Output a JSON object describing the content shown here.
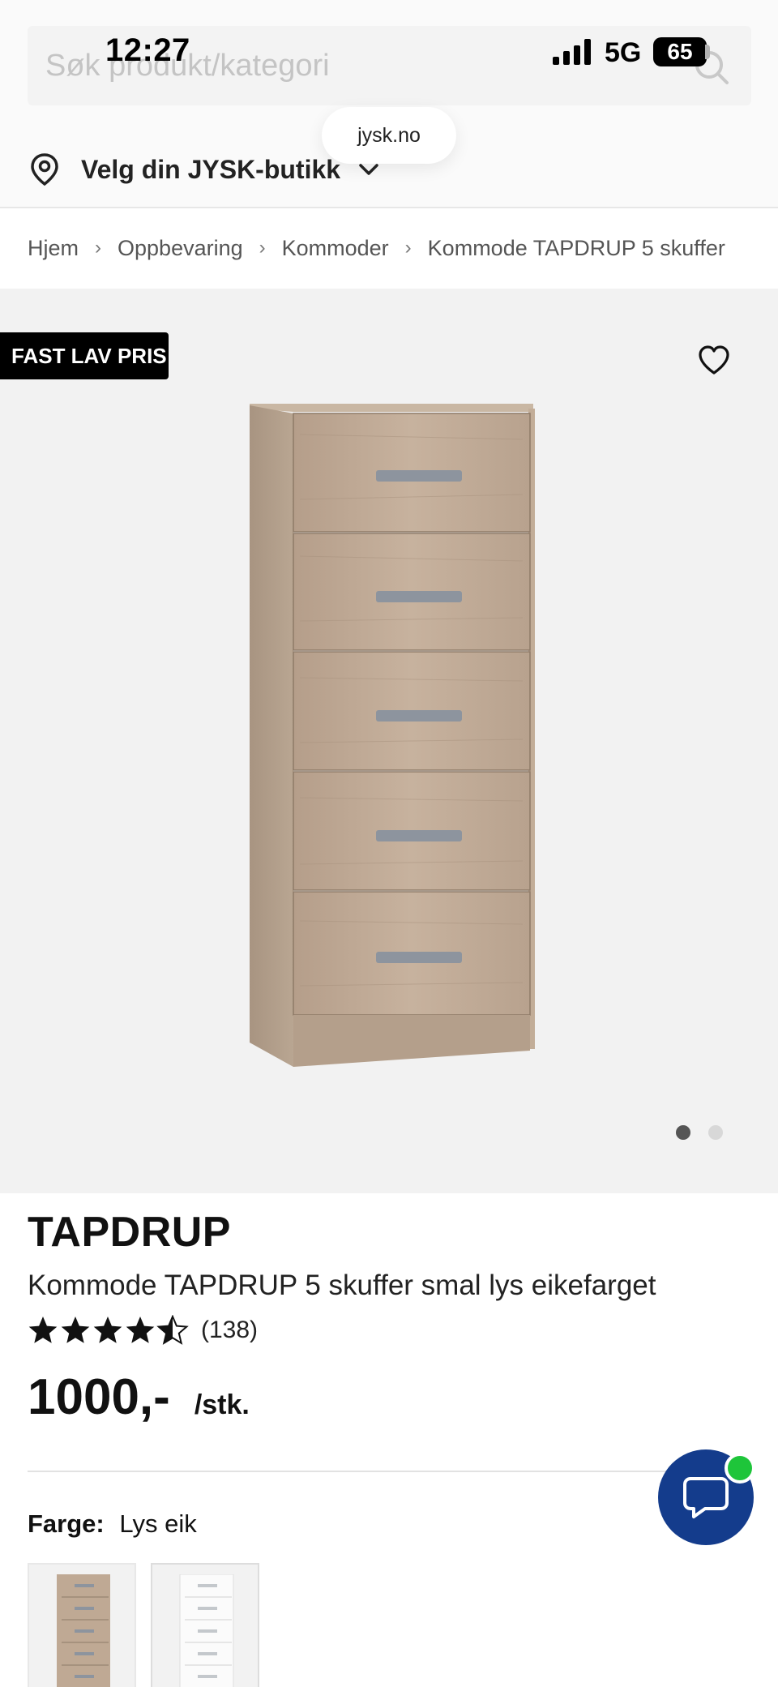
{
  "status_bar": {
    "time": "12:27",
    "network": "5G",
    "battery": "65"
  },
  "search": {
    "placeholder": "Søk produkt/kategori",
    "icon": "search-icon"
  },
  "browser": {
    "url": "jysk.no"
  },
  "store_selector": {
    "label": "Velg din JYSK-butikk",
    "icon": "map-pin-icon"
  },
  "breadcrumb": [
    "Hjem",
    "Oppbevaring",
    "Kommoder",
    "Kommode TAPDRUP 5 skuffer"
  ],
  "gallery": {
    "badge": "FAST LAV PRIS",
    "image_count": 2,
    "active_index": 0
  },
  "product": {
    "brand": "TAPDRUP",
    "title": "Kommode TAPDRUP 5 skuffer smal lys eikefarget",
    "rating": 4.5,
    "review_count": "(138)",
    "price": "1000,-",
    "price_unit": "/stk.",
    "color_label": "Farge:",
    "color_value": "Lys eik",
    "swatches": [
      "Lys eik",
      "Hvit"
    ]
  },
  "colors": {
    "chat_bg": "#143c8c",
    "online": "#1ec53a",
    "badge_bg": "#000000"
  }
}
